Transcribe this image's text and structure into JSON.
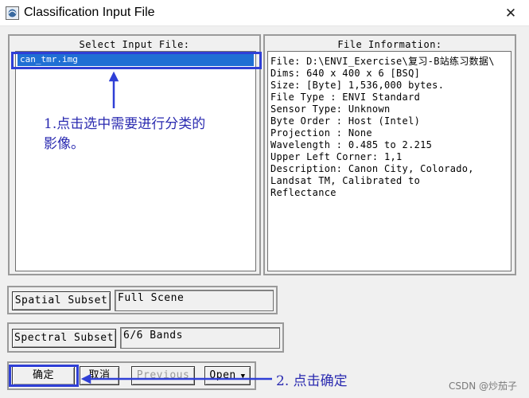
{
  "window": {
    "title": "Classification Input File",
    "close_glyph": "✕"
  },
  "input_panel": {
    "label": "Select Input File:",
    "files": [
      "can_tmr.img"
    ],
    "selected_index": 0
  },
  "info_panel": {
    "label": "File Information:",
    "lines": [
      "File: D:\\ENVI_Exercise\\复习-B站练习数据\\",
      "Dims: 640 x 400 x 6 [BSQ]",
      "Size: [Byte] 1,536,000 bytes.",
      "File Type  : ENVI Standard",
      "Sensor Type: Unknown",
      "Byte Order : Host (Intel)",
      "Projection : None",
      "Wavelength : 0.485 to 2.215",
      "Upper Left Corner: 1,1",
      "Description: Canon City, Colorado,",
      "Landsat TM, Calibrated to",
      "Reflectance"
    ]
  },
  "spatial_subset": {
    "button_label": "Spatial Subset",
    "value": "Full Scene"
  },
  "spectral_subset": {
    "button_label": "Spectral Subset",
    "value": "6/6 Bands"
  },
  "buttons": {
    "ok": "确定",
    "cancel": "取消",
    "previous": "Previous",
    "open": "Open"
  },
  "annotations": {
    "step1_line1": "1.点击选中需要进行分类的",
    "step1_line2": "影像。",
    "step2": "2. 点击确定",
    "color": "#2f3fd6"
  },
  "watermark": "CSDN @炒茄子"
}
